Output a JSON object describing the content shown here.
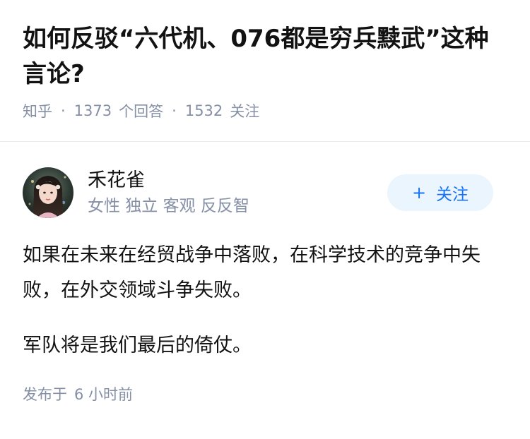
{
  "question": {
    "title": "如何反驳“六代机、076都是穷兵黩武”这种言论?",
    "source": "知乎",
    "answer_count": "1373",
    "answer_label": "个回答",
    "follower_count": "1532",
    "follower_label": "关注"
  },
  "answer": {
    "author": {
      "name": "禾花雀",
      "bio": "女性 独立 客观 反反智",
      "avatar_icon": "avatar-photo"
    },
    "follow_button": {
      "plus": "+",
      "label": "关注"
    },
    "paragraphs": [
      "如果在未来在经贸战争中落败，在科学技术的竞争中失败，在外交领域斗争失败。",
      "军队将是我们最后的倚仗。"
    ],
    "posted_label": "发布于",
    "posted_time": "6 小时前"
  },
  "colors": {
    "meta_gray": "#8590a6",
    "accent_blue": "#1772f6",
    "button_bg": "#ebf5fd"
  }
}
